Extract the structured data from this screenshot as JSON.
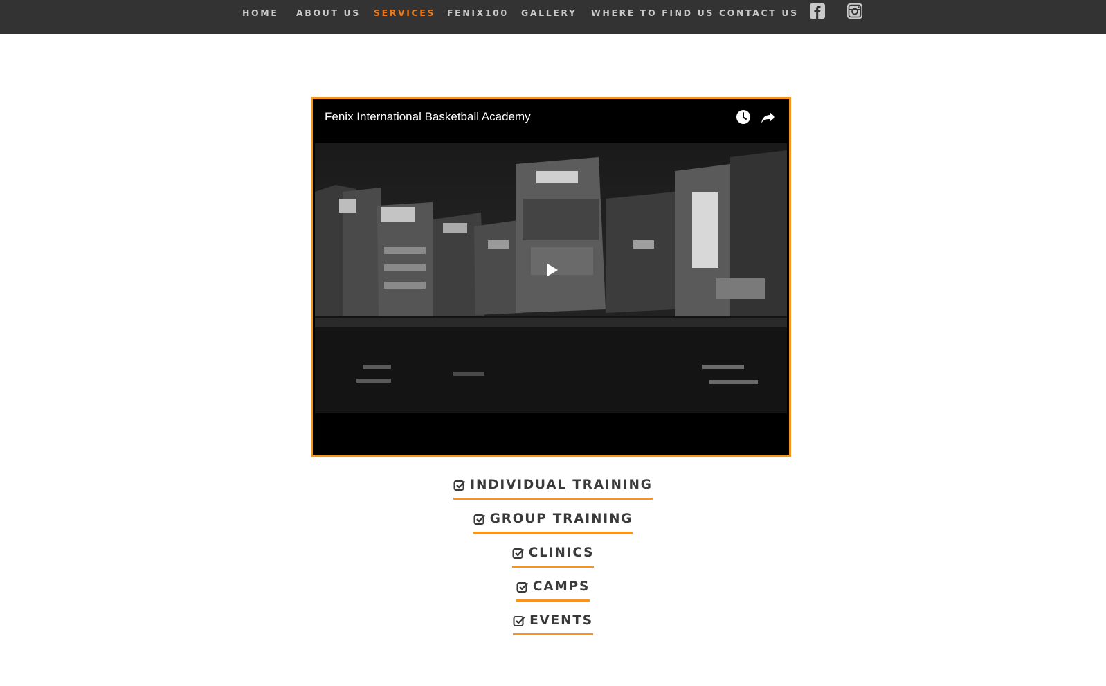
{
  "nav": {
    "items": [
      {
        "label": "HOME"
      },
      {
        "label": "ABOUT US"
      },
      {
        "label": "SERVICES"
      },
      {
        "label": "FENIX100"
      },
      {
        "label": "GALLERY"
      },
      {
        "label": "WHERE TO FIND US"
      },
      {
        "label": "CONTACT US"
      }
    ],
    "active": "SERVICES",
    "social": [
      "facebook-icon",
      "instagram-icon"
    ]
  },
  "video": {
    "title": "Fenix International Basketball Academy",
    "actions": [
      "watch-later-icon",
      "share-icon"
    ],
    "play_icon": "play-icon"
  },
  "services": [
    {
      "label": "INDIVIDUAL TRAINING"
    },
    {
      "label": "GROUP TRAINING"
    },
    {
      "label": "CLINICS"
    },
    {
      "label": "CAMPS"
    },
    {
      "label": "EVENTS"
    }
  ],
  "colors": {
    "topbar": "#333333",
    "nav_text": "#c9c9c9",
    "nav_active": "#ee7a1a",
    "accent": "#f7941d",
    "service_text": "#3a3a3a"
  }
}
